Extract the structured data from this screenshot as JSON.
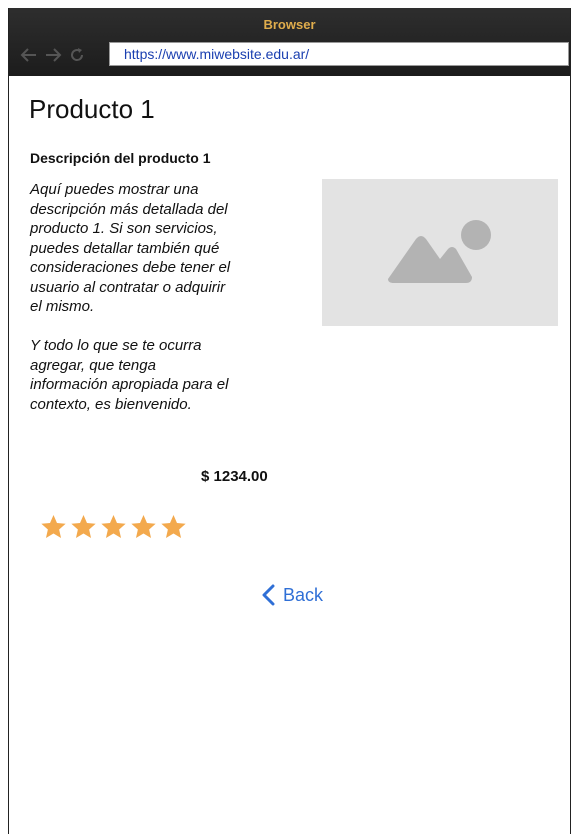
{
  "window": {
    "title": "Browser"
  },
  "address_bar": {
    "url": "https://www.miwebsite.edu.ar/"
  },
  "icons": {
    "back": "arrow-left-icon",
    "forward": "arrow-right-icon",
    "reload": "reload-icon",
    "image": "image-placeholder-icon",
    "star": "star-icon",
    "chevron": "chevron-left-icon"
  },
  "colors": {
    "title_bar_text": "#e0ad4c",
    "url_text": "#1a3fb0",
    "star": "#f3a94d",
    "link": "#2f6fd6",
    "placeholder_bg": "#e3e3e3",
    "placeholder_icon": "#b3b3b3"
  },
  "product": {
    "title": "Producto 1",
    "subtitle": "Descripción del producto 1",
    "description_paragraphs": [
      "Aquí puedes mostrar una\ndescripción más detallada del\nproducto 1. Si son servicios,\npuedes detallar también qué\nconsideraciones debe tener el\nusuario al contratar o adquirir\nel mismo.",
      "Y todo lo que se te ocurra\nagregar, que tenga\ninformación apropiada para el\ncontexto, es bienvenido."
    ],
    "price": "$ 1234.00",
    "rating": {
      "value": 5,
      "max": 5
    }
  },
  "navigation": {
    "back_label": "Back"
  }
}
